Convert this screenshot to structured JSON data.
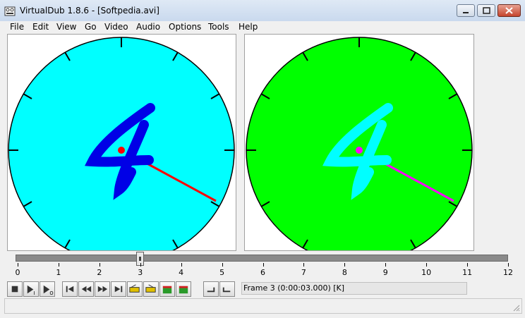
{
  "window": {
    "title": "VirtualDub 1.8.6 - [Softpedia.avi]",
    "accent": "#c5432c"
  },
  "menu": {
    "items": [
      "File",
      "Edit",
      "View",
      "Go",
      "Video",
      "Audio",
      "Options",
      "Tools",
      "Help"
    ]
  },
  "panes": {
    "input": {
      "face_color": "#00ffff",
      "digit": "4",
      "digit_color": "#0000ff",
      "hand_color": "#ff0000"
    },
    "output": {
      "face_color": "#00ff00",
      "digit": "4",
      "digit_color": "#00ffff",
      "hand_color": "#ff00ff"
    }
  },
  "timeline": {
    "ticks": [
      "0",
      "1",
      "2",
      "3",
      "4",
      "5",
      "6",
      "7",
      "8",
      "9",
      "10",
      "11",
      "12"
    ],
    "min": 0,
    "max": 12,
    "position": 3
  },
  "toolbar": {
    "buttons": [
      {
        "name": "stop-button",
        "icon": "stop-icon"
      },
      {
        "name": "play-input-button",
        "icon": "play-input-icon"
      },
      {
        "name": "play-output-button",
        "icon": "play-output-icon"
      },
      {
        "name": "start-button",
        "icon": "go-start-icon"
      },
      {
        "name": "prev-frame-button",
        "icon": "prev-frame-icon"
      },
      {
        "name": "next-frame-button",
        "icon": "next-frame-icon"
      },
      {
        "name": "end-button",
        "icon": "go-end-icon"
      },
      {
        "name": "prev-keyframe-button",
        "icon": "prev-keyframe-icon"
      },
      {
        "name": "next-keyframe-button",
        "icon": "next-keyframe-icon"
      },
      {
        "name": "prev-scene-button",
        "icon": "prev-scene-icon"
      },
      {
        "name": "next-scene-button",
        "icon": "next-scene-icon"
      },
      {
        "name": "mark-in-button",
        "icon": "mark-in-icon"
      },
      {
        "name": "mark-out-button",
        "icon": "mark-out-icon"
      }
    ]
  },
  "status": {
    "frame_info": "Frame 3 (0:00:03.000) [K]"
  }
}
